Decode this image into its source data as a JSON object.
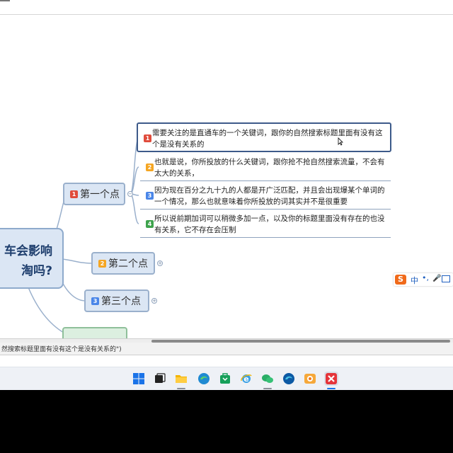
{
  "mindmap": {
    "root": {
      "line1": "车会影响",
      "line2": "淘吗?"
    },
    "topics": [
      {
        "num": "1",
        "label": "第一个点",
        "color": "#e04c3c"
      },
      {
        "num": "2",
        "label": "第二个点",
        "color": "#f5a623"
      },
      {
        "num": "3",
        "label": "第三个点",
        "color": "#4a86e8"
      }
    ],
    "leaves": [
      {
        "num": "1",
        "color": "#e04c3c",
        "text": "需要关注的是直通车的一个关键词，跟你的自然搜索标题里面有没有这个是没有关系的"
      },
      {
        "num": "2",
        "color": "#f5a623",
        "text": "也就是说，你所投放的什么关键词，跟你抢不抢自然搜索流量，不会有太大的关系，"
      },
      {
        "num": "3",
        "color": "#4a86e8",
        "text": "因为现在百分之九十九的人都是开广泛匹配，并且会出现爆某个单词的一个情况，那么也就意味着你所投放的词其实并不是很重要"
      },
      {
        "num": "4",
        "color": "#3fa34d",
        "text": "所以说前期加词可以稍微多加一点，以及你的标题里面没有存在的也没有关系，它不存在会压制"
      }
    ]
  },
  "status": {
    "text": "然搜索标题里面有没有这个是没有关系的\")"
  },
  "ime": {
    "logo": "S",
    "lang": "中",
    "punct": "•,",
    "mic": "🎤"
  },
  "taskbar": {
    "apps": [
      "windows-start",
      "task-view",
      "file-explorer",
      "edge",
      "store",
      "ie",
      "wechat",
      "edge-dev",
      "image-viewer",
      "xmind"
    ]
  }
}
